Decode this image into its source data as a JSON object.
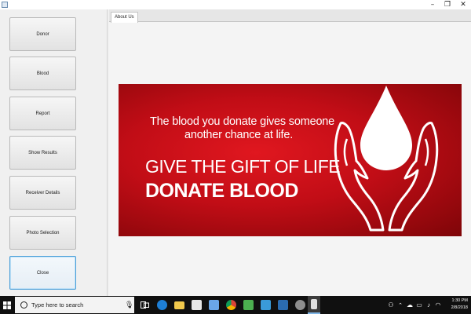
{
  "window": {
    "minimize": "–",
    "maximize": "❐",
    "close": "✕"
  },
  "sidebar": {
    "buttons": [
      {
        "label": "Donor"
      },
      {
        "label": "Blood"
      },
      {
        "label": "Report"
      },
      {
        "label": "Show Results"
      },
      {
        "label": "Receiver Details"
      },
      {
        "label": "Photo Selection"
      },
      {
        "label": "Close"
      }
    ]
  },
  "tabs": [
    {
      "label": "About Us",
      "selected": true
    }
  ],
  "banner": {
    "line1": "The blood you donate gives someone",
    "line2": "another chance at life.",
    "line3": "GIVE THE GIFT OF LIFE",
    "line4": "DONATE BLOOD",
    "background_color": "#c10d16",
    "icon": "blood-drop-hands"
  },
  "taskbar": {
    "search_placeholder": "Type here to search",
    "apps": [
      "task-view",
      "edge",
      "file-explorer",
      "store",
      "chrome",
      "app-green",
      "photos",
      "virtualbox",
      "app-gear",
      "java-app"
    ],
    "time": "1:30 PM",
    "date": "2/8/2018"
  }
}
